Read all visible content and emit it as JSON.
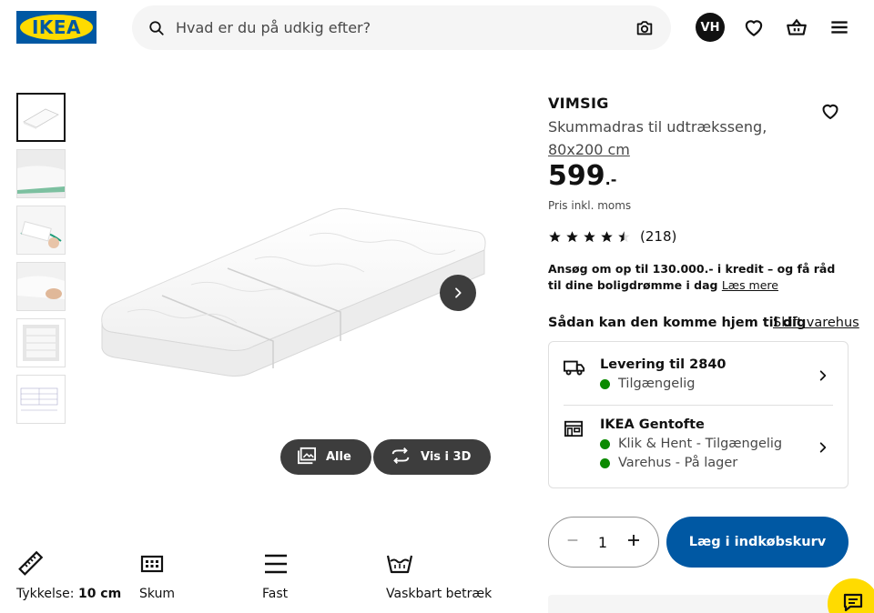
{
  "header": {
    "logo_text": "IKEA",
    "search_placeholder": "Hvad er du på udkig efter?",
    "avatar_initials": "VH"
  },
  "gallery": {
    "show_all_label": "Alle",
    "view_3d_label": "Vis i 3D"
  },
  "features": [
    {
      "label_prefix": "Tykkelse:",
      "label_value": "10 cm",
      "icon": "ruler-icon"
    },
    {
      "label": "Skum",
      "icon": "foam-icon"
    },
    {
      "label": "Fast",
      "icon": "firmness-icon"
    },
    {
      "label": "Vaskbart betræk",
      "icon": "washable-icon"
    }
  ],
  "product": {
    "name": "VIMSIG",
    "description": "Skummadras til udtræksseng,",
    "size": "80x200 cm",
    "price": "599",
    "price_suffix": ".-",
    "vat_note": "Pris inkl. moms",
    "rating": 4.5,
    "review_count": "(218)"
  },
  "credit": {
    "text": "Ansøg om op til 130.000.- i kredit – og få råd til dine boligdrømme i dag",
    "link": "Læs mere"
  },
  "delivery": {
    "heading": "Sådan kan den komme hjem til dig",
    "change_store": "Skift varehus",
    "shipping_title": "Levering til 2840",
    "shipping_status": "Tilgængelig",
    "store_title": "IKEA Gentofte",
    "store_click_collect": "Klik & Hent - Tilgængelig",
    "store_stock": "Varehus - På lager",
    "status_color": "#0a8a00"
  },
  "cart": {
    "quantity": "1",
    "add_label": "Læg i indkøbskurv",
    "brand_blue": "#0058a3",
    "brand_yellow": "#ffdb00"
  }
}
